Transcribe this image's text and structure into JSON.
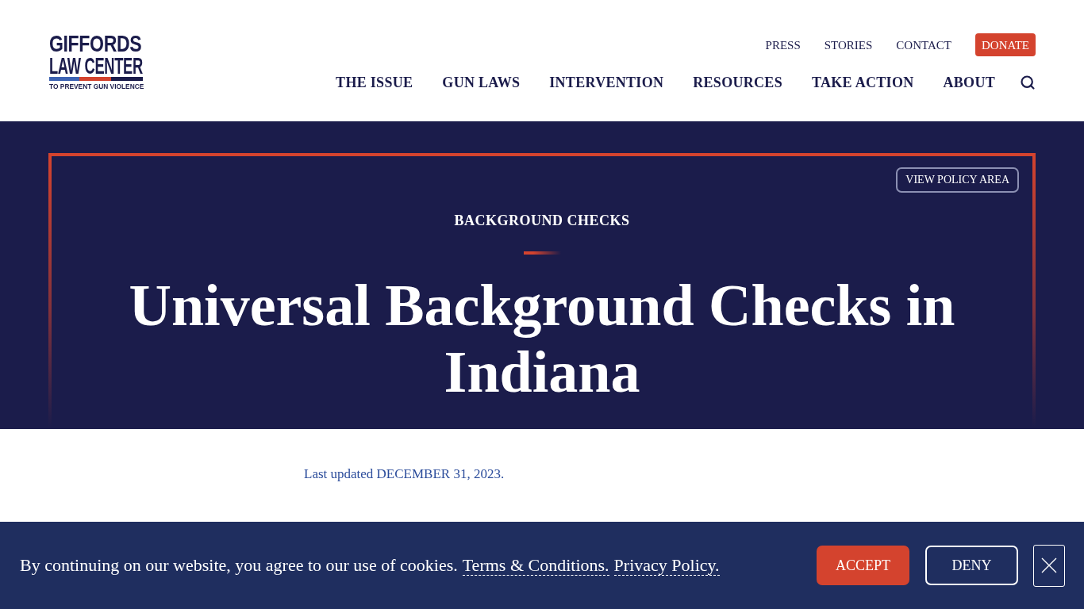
{
  "header": {
    "logo": {
      "lines": [
        "GIFFORDS",
        "LAW CENTER"
      ],
      "tagline": "TO PREVENT GUN VIOLENCE"
    },
    "utility_links": [
      {
        "label": "PRESS",
        "kind": "link"
      },
      {
        "label": "STORIES",
        "kind": "link"
      },
      {
        "label": "CONTACT",
        "kind": "link"
      },
      {
        "label": "DONATE",
        "kind": "button"
      }
    ],
    "nav": [
      "THE ISSUE",
      "GUN LAWS",
      "INTERVENTION",
      "RESOURCES",
      "TAKE ACTION",
      "ABOUT"
    ]
  },
  "hero": {
    "policy_button": "VIEW POLICY AREA",
    "eyebrow": "BACKGROUND CHECKS",
    "title": "Universal Background Checks in Indiana"
  },
  "article": {
    "last_updated": "Last updated DECEMBER 31, 2023."
  },
  "cookie_banner": {
    "message": "By continuing on our website, you agree to our use of cookies.",
    "links": [
      "Terms & Conditions.",
      "Privacy Policy."
    ],
    "buttons": [
      {
        "label": "ACCEPT",
        "kind": "primary"
      },
      {
        "label": "DENY",
        "kind": "outline"
      }
    ]
  }
}
